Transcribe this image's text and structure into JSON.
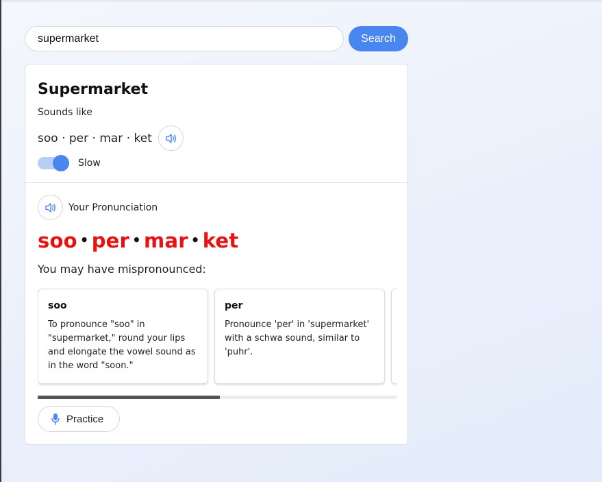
{
  "search": {
    "value": "supermarket",
    "button_label": "Search"
  },
  "result": {
    "title": "Supermarket",
    "sounds_like_label": "Sounds like",
    "syllables_text": "soo · per · mar · ket",
    "slow_label": "Slow",
    "slow_toggle_on": true
  },
  "pronunciation": {
    "label": "Your Pronunciation",
    "syllables": [
      "soo",
      "per",
      "mar",
      "ket"
    ],
    "syllable_color": "#e81212",
    "mispronounced_label": "You may have mispronounced:"
  },
  "tips": [
    {
      "title": "soo",
      "text": "To pronounce \"soo\" in \"supermarket,\" round your lips and elongate the vowel sound as in the word \"soon.\""
    },
    {
      "title": "per",
      "text": "Pronounce 'per' in 'supermarket' with a schwa sound, similar to 'puhr'."
    }
  ],
  "practice": {
    "label": "Practice"
  },
  "colors": {
    "accent": "#4a86f0",
    "error": "#e81212"
  }
}
